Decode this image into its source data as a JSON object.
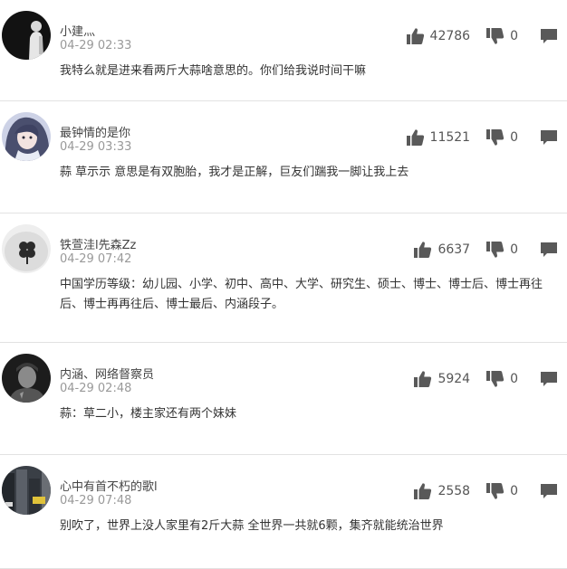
{
  "comments": [
    {
      "username": "小建灬",
      "time": "04-29 02:33",
      "text": "我特么就是进来看两斤大蒜啥意思的。你们给我说时间干嘛",
      "likes": "42786",
      "dislikes": "0",
      "avatar_icon": "avatar-person-dark"
    },
    {
      "username": "最钟情的是你",
      "time": "04-29 03:33",
      "text": "蒜 草示示 意思是有双胞胎，我才是正解，巨友们踹我一脚让我上去",
      "likes": "11521",
      "dislikes": "0",
      "avatar_icon": "avatar-anime-girl"
    },
    {
      "username": "铁萱洼l先森Zz",
      "time": "04-29 07:42",
      "text": "中国学历等级：幼儿园、小学、初中、高中、大学、研究生、硕士、博士、博士后、博士再往后、博士再再往后、博士最后、内涵段子。",
      "likes": "6637",
      "dislikes": "0",
      "avatar_icon": "avatar-clover-tattoo"
    },
    {
      "username": "内涵、网络督察员",
      "time": "04-29 02:48",
      "text": "蒜：草二小，楼主家还有两个妹妹",
      "likes": "5924",
      "dislikes": "0",
      "avatar_icon": "avatar-man-cap"
    },
    {
      "username": "心中有首不朽的歌l",
      "time": "04-29 07:48",
      "text": "别吹了，世界上没人家里有2斤大蒜 全世界一共就6颗，集齐就能统治世界",
      "likes": "2558",
      "dislikes": "0",
      "avatar_icon": "avatar-street-scene"
    }
  ],
  "icons": {
    "like": "thumbs-up-icon",
    "dislike": "thumbs-down-icon",
    "reply": "comment-bubble-icon"
  },
  "colors": {
    "icon": "#595959",
    "divider": "#e2e2e2",
    "username": "#444444",
    "timestamp": "#999999"
  }
}
